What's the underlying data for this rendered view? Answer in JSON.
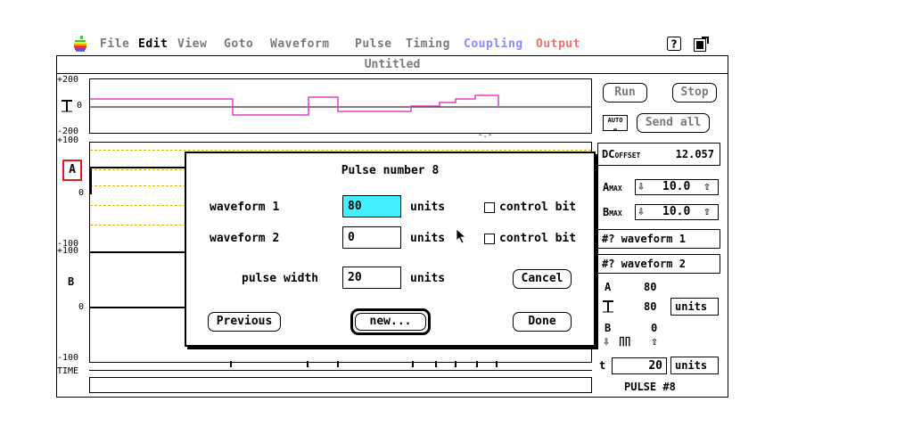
{
  "menubar": {
    "items": [
      {
        "label": "File",
        "color": "#6c6c6c"
      },
      {
        "label": "Edit",
        "color": "#000000"
      },
      {
        "label": "View",
        "color": "#6c6c6c"
      },
      {
        "label": "Goto",
        "color": "#6c6c6c"
      },
      {
        "label": "Waveform",
        "color": "#6c6c6c"
      },
      {
        "label": "Pulse",
        "color": "#6c6c6c"
      },
      {
        "label": "Timing",
        "color": "#6c6c6c"
      },
      {
        "label": "Coupling",
        "color": "#8a8aff"
      },
      {
        "label": "Output",
        "color": "#f07070"
      }
    ],
    "help_icon": "help-icon",
    "extras_icon": "reload-icon"
  },
  "window": {
    "title": "Untitled"
  },
  "plots": {
    "top_labels": [
      "+200",
      "0",
      "-200"
    ],
    "a_labels": [
      "+100",
      "0",
      "-100"
    ],
    "a_name": "A",
    "b_labels": [
      "+100",
      "0",
      "-100"
    ],
    "b_name": "B",
    "time_label": "TIME",
    "pulse_trace_color": "#e040c0",
    "dash_color": "#e0b000",
    "pulse_levels": [
      0,
      0,
      0,
      -25,
      -5,
      -15,
      -15,
      -8,
      -5,
      -2,
      0
    ]
  },
  "right_panel": {
    "run": "Run",
    "stop": "Stop",
    "auto_icon": "AUTO",
    "send_all": "Send all",
    "dc_label": "DC",
    "dc_sub": "OFFSET",
    "dc_value": "12.057",
    "amax_label": "A",
    "amax_sub": "MAX",
    "amax_value": "10.0",
    "bmax_label": "B",
    "bmax_sub": "MAX",
    "bmax_value": "10.0",
    "waveform1": "#? waveform 1",
    "waveform2": "#? waveform 2",
    "a_label": "A",
    "a_value": "80",
    "amp_value": "80",
    "units_btn": "units",
    "b_label": "B",
    "b_value": "0",
    "t_label": "t",
    "t_value": "20",
    "t_units": "units",
    "pulse_label": "PULSE #8"
  },
  "dialog": {
    "title": "Pulse number  8",
    "waveform1_label": "waveform  1",
    "waveform1_value": "80",
    "waveform2_label": "waveform  2",
    "waveform2_value": "0",
    "units": "units",
    "control_bit": "control bit",
    "pulse_width_label": "pulse width",
    "pulse_width_value": "20",
    "cancel": "Cancel",
    "previous": "Previous",
    "new": "new...",
    "done": "Done"
  }
}
